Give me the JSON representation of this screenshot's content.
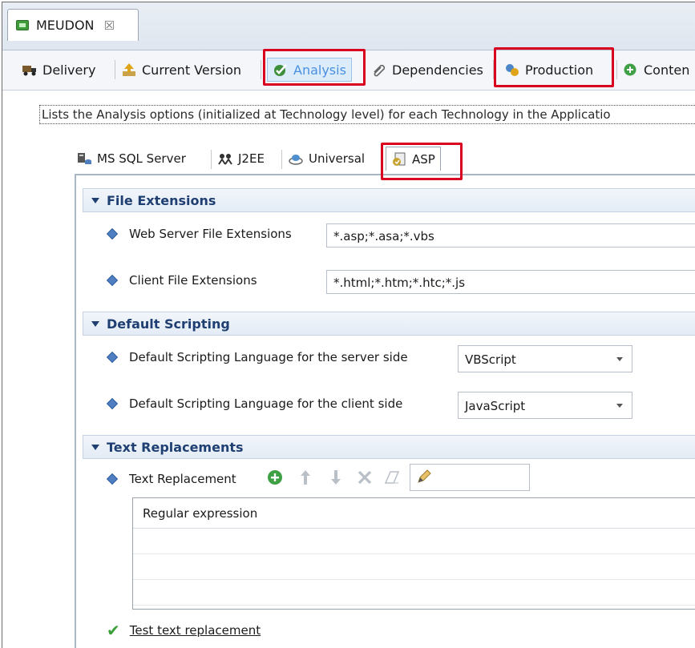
{
  "editor_tab": {
    "title": "MEUDON",
    "close": "☒"
  },
  "page_tabs": [
    {
      "label": "Delivery",
      "icon": "truck-icon"
    },
    {
      "label": "Current Version",
      "icon": "upload-arrow-icon"
    },
    {
      "label": "Analysis",
      "icon": "analysis-check-icon",
      "selected": true
    },
    {
      "label": "Dependencies",
      "icon": "paperclip-icon"
    },
    {
      "label": "Production",
      "icon": "gears-icon"
    },
    {
      "label": "Conten",
      "icon": "add-green-icon"
    }
  ],
  "description": "Lists the Analysis options (initialized at Technology level) for each Technology in the Applicatio",
  "tech_tabs": [
    {
      "label": "MS SQL Server",
      "icon": "database-server-icon"
    },
    {
      "label": "J2EE",
      "icon": "j2ee-icon"
    },
    {
      "label": "Universal",
      "icon": "universal-icon"
    },
    {
      "label": "ASP",
      "icon": "asp-page-icon",
      "selected": true
    }
  ],
  "sections": {
    "file_extensions": {
      "title": "File Extensions",
      "web_label": "Web Server File Extensions",
      "web_value": "*.asp;*.asa;*.vbs",
      "client_label": "Client File Extensions",
      "client_value": "*.html;*.htm;*.htc;*.js"
    },
    "default_scripting": {
      "title": "Default Scripting",
      "server_label": "Default Scripting Language for the server side",
      "server_value": "VBScript",
      "client_label": "Default Scripting Language for the client side",
      "client_value": "JavaScript"
    },
    "text_replacements": {
      "title": "Text Replacements",
      "label": "Text Replacement",
      "column_header": "Regular expression",
      "test_link": "Test text replacement"
    }
  },
  "colors": {
    "highlight": "#d8001e",
    "selected_tab_text": "#4a90e0",
    "section_title": "#1f3f72"
  }
}
